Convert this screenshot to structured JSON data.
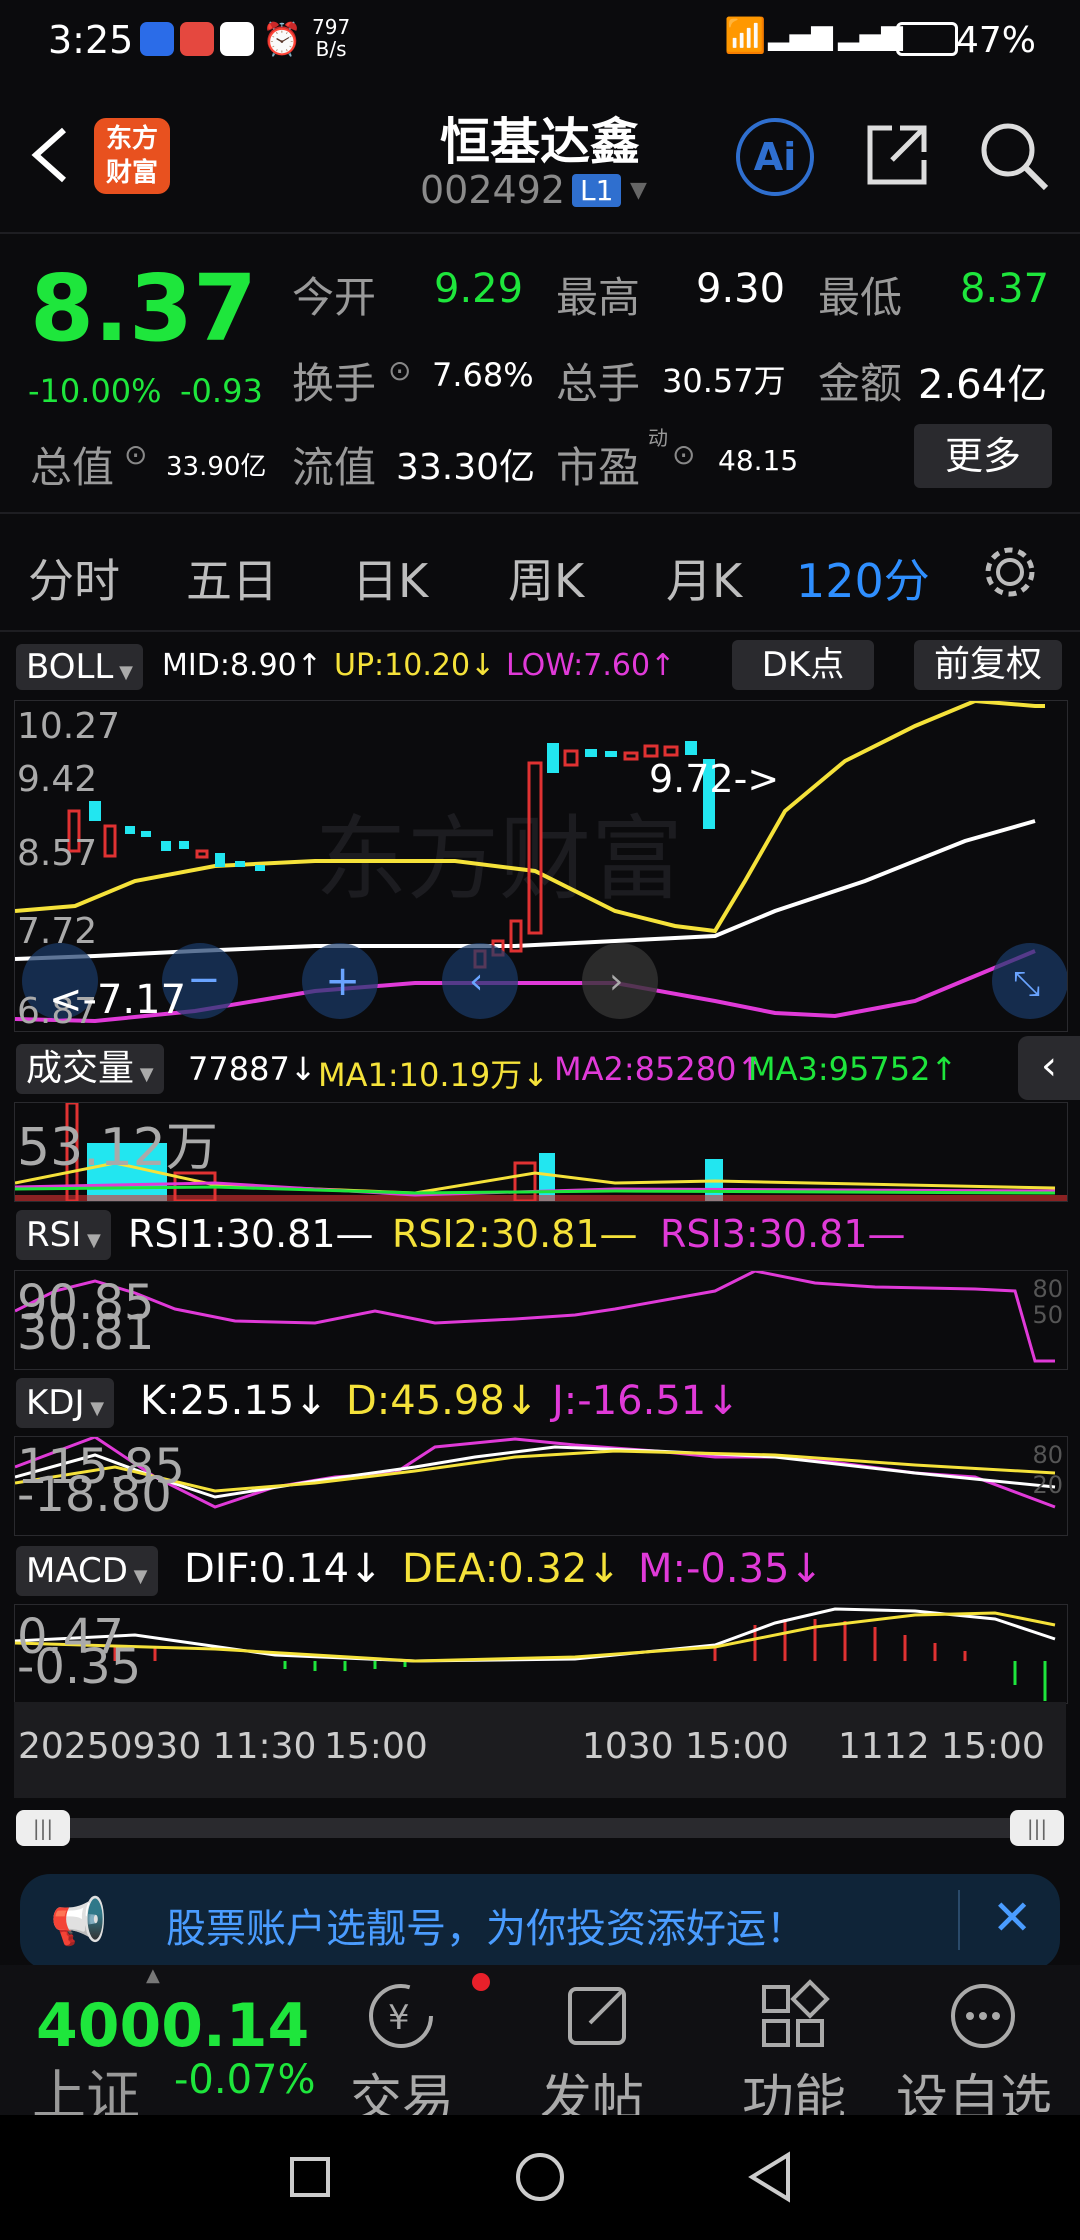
{
  "status_bar": {
    "time": "3:25",
    "net_speed": "797",
    "net_unit": "B/s",
    "battery": "47%"
  },
  "header": {
    "title": "恒基达鑫",
    "code": "002492",
    "level": "L1",
    "logo_top": "东方",
    "logo_bottom": "财富",
    "ai_label": "Ai"
  },
  "quote": {
    "price": "8.37",
    "change_pct": "-10.00%",
    "change_abs": "-0.93",
    "open_label": "今开",
    "open": "9.29",
    "high_label": "最高",
    "high": "9.30",
    "low_label": "最低",
    "low": "8.37",
    "turnover_label": "换手",
    "turnover": "7.68%",
    "volume_label": "总手",
    "volume": "30.57万",
    "amount_label": "金额",
    "amount": "2.64亿",
    "mcap_label": "总值",
    "mcap": "33.90亿",
    "float_label": "流值",
    "float": "33.30亿",
    "pe_label": "市盈",
    "pe_sup": "动",
    "pe": "48.15",
    "more": "更多"
  },
  "tabs": [
    "分时",
    "五日",
    "日K",
    "周K",
    "月K",
    "120分"
  ],
  "boll": {
    "name": "BOLL",
    "mid": "MID:8.90↑",
    "up": "UP:10.20↓",
    "low": "LOW:7.60↑",
    "dk": "DK点",
    "adjust": "前复权",
    "yticks": [
      "10.27",
      "9.42",
      "8.57",
      "7.72",
      "6.87"
    ],
    "hi_note": "9.72->",
    "lo_note": "<-7.17",
    "watermark": "东方财富"
  },
  "vol": {
    "name": "成交量",
    "v": "77887↓",
    "ma1": "MA1:10.19万↓",
    "ma2": "MA2:85280↑",
    "ma3": "MA3:95752↑",
    "ytick": "53.12万"
  },
  "rsi": {
    "name": "RSI",
    "r1": "RSI1:30.81—",
    "r2": "RSI2:30.81—",
    "r3": "RSI3:30.81—",
    "yt1": "90.85",
    "yt2": "30.81",
    "rt1": "80",
    "rt2": "50"
  },
  "kdj": {
    "name": "KDJ",
    "k": "K:25.15↓",
    "d": "D:45.98↓",
    "j": "J:-16.51↓",
    "yt1": "115.85",
    "yt2": "-18.80",
    "rt1": "80",
    "rt2": "20"
  },
  "macd": {
    "name": "MACD",
    "dif": "DIF:0.14↓",
    "dea": "DEA:0.32↓",
    "m": "M:-0.35↓",
    "yt1": "0.47",
    "yt2": "-0.35"
  },
  "dates": {
    "d1": "20250930 11:30",
    "d1b": "15:00",
    "d2": "1030 15:00",
    "d3": "1112 15:00"
  },
  "banner": {
    "text": "股票账户选靓号，为你投资添好运！"
  },
  "bottom": {
    "index_value": "4000.14",
    "index_name": "上证",
    "index_chg": "-0.07%",
    "trade": "交易",
    "post": "发帖",
    "func": "功能",
    "watch": "设自选"
  },
  "colors": {
    "up": "#e03232",
    "down": "#1ee63c",
    "yellow": "#f5e23a",
    "magenta": "#e03ad8",
    "white": "#ffffff",
    "cyan": "#22e6f0",
    "blue": "#2f6fcf"
  }
}
